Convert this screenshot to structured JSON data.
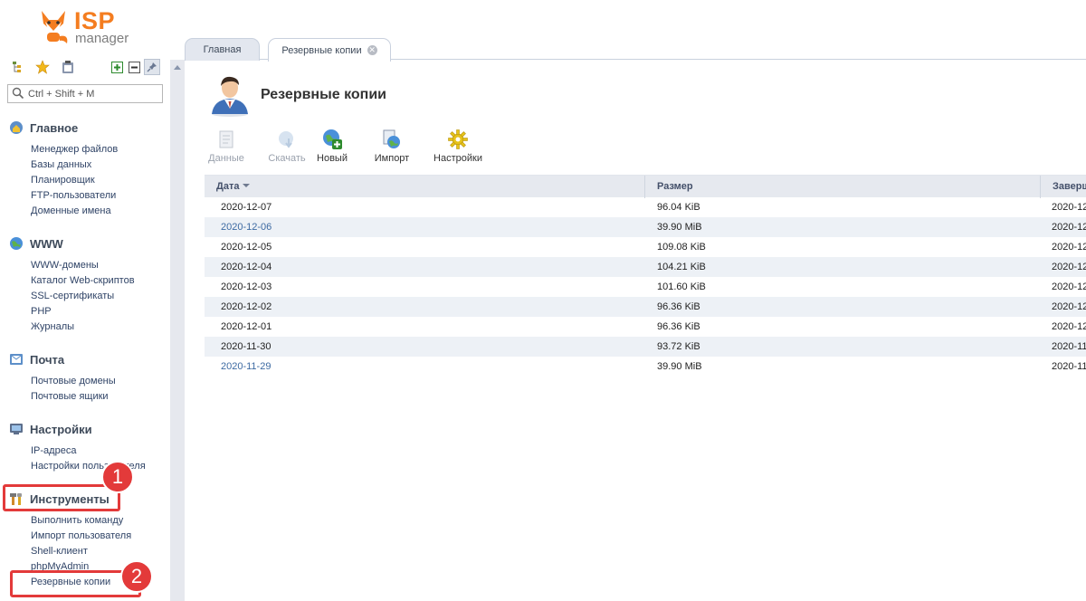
{
  "app": {
    "logo_top": "ISP",
    "logo_bottom": "manager"
  },
  "search": {
    "placeholder": "Ctrl + Shift + M"
  },
  "sidebar": {
    "sections": [
      {
        "title": "Главное",
        "icon": "home-icon",
        "items": [
          "Менеджер файлов",
          "Базы данных",
          "Планировщик",
          "FTP-пользователи",
          "Доменные имена"
        ]
      },
      {
        "title": "WWW",
        "icon": "globe-icon",
        "items": [
          "WWW-домены",
          "Каталог Web-скриптов",
          "SSL-сертификаты",
          "PHP",
          "Журналы"
        ]
      },
      {
        "title": "Почта",
        "icon": "mail-icon",
        "items": [
          "Почтовые домены",
          "Почтовые ящики"
        ]
      },
      {
        "title": "Настройки",
        "icon": "monitor-settings-icon",
        "items": [
          "IP-адреса",
          "Настройки пользователя"
        ]
      },
      {
        "title": "Инструменты",
        "icon": "tools-icon",
        "items": [
          "Выполнить команду",
          "Импорт пользователя",
          "Shell-клиент",
          "phpMyAdmin",
          "Резервные копии"
        ]
      }
    ]
  },
  "annotations": {
    "badge1": "1",
    "badge2": "2",
    "color": "#e33a3a"
  },
  "tabs": [
    {
      "label": "Главная",
      "active": false
    },
    {
      "label": "Резервные копии",
      "active": true,
      "closable": true
    }
  ],
  "page": {
    "title": "Резервные копии"
  },
  "toolbar": [
    {
      "label": "Данные",
      "icon": "data-icon",
      "enabled": false
    },
    {
      "label": "Скачать",
      "icon": "download-icon",
      "enabled": false
    },
    {
      "label": "Новый",
      "icon": "new-icon",
      "enabled": true
    },
    {
      "label": "Импорт",
      "icon": "import-icon",
      "enabled": true
    },
    {
      "label": "Настройки",
      "icon": "settings-gear-icon",
      "enabled": true
    }
  ],
  "table": {
    "columns": [
      "Дата",
      "Размер",
      "Заверш"
    ],
    "rows": [
      {
        "date": "2020-12-07",
        "size": "96.04 KiB",
        "done": "2020-12",
        "link": false
      },
      {
        "date": "2020-12-06",
        "size": "39.90 MiB",
        "done": "2020-12",
        "link": true
      },
      {
        "date": "2020-12-05",
        "size": "109.08 KiB",
        "done": "2020-12",
        "link": false
      },
      {
        "date": "2020-12-04",
        "size": "104.21 KiB",
        "done": "2020-12",
        "link": false
      },
      {
        "date": "2020-12-03",
        "size": "101.60 KiB",
        "done": "2020-12",
        "link": false
      },
      {
        "date": "2020-12-02",
        "size": "96.36 KiB",
        "done": "2020-12",
        "link": false
      },
      {
        "date": "2020-12-01",
        "size": "96.36 KiB",
        "done": "2020-12",
        "link": false
      },
      {
        "date": "2020-11-30",
        "size": "93.72 KiB",
        "done": "2020-11",
        "link": false
      },
      {
        "date": "2020-11-29",
        "size": "39.90 MiB",
        "done": "2020-11",
        "link": true
      }
    ]
  }
}
